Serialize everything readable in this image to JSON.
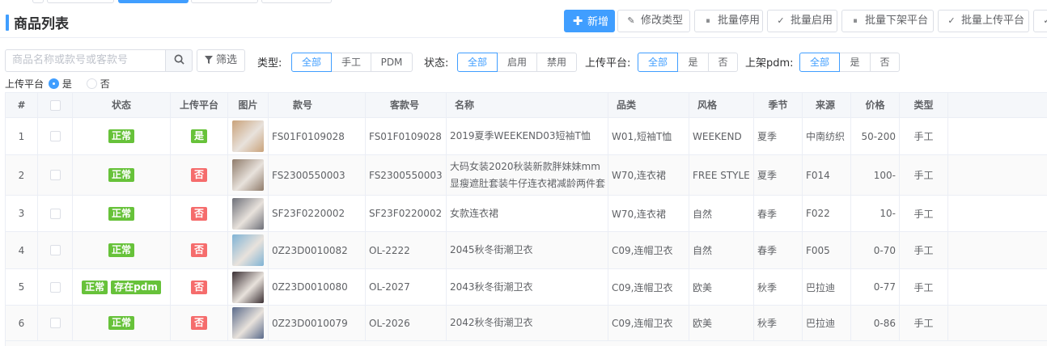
{
  "page": {
    "title": "商品列表"
  },
  "toolbar": [
    {
      "label": "新增",
      "icon": "plus-icon",
      "glyph": "✚",
      "primary": true
    },
    {
      "label": "修改类型",
      "icon": "edit-icon",
      "glyph": "✎",
      "primary": false
    },
    {
      "label": "批量停用",
      "icon": "pause-icon",
      "glyph": "⏸",
      "primary": false
    },
    {
      "label": "批量启用",
      "icon": "check-icon",
      "glyph": "✓",
      "primary": false
    },
    {
      "label": "批量下架平台",
      "icon": "pause-icon",
      "glyph": "⏸",
      "primary": false
    },
    {
      "label": "批量上传平台",
      "icon": "check-icon",
      "glyph": "✓",
      "primary": false
    }
  ],
  "search": {
    "placeholder": "商品名称或款号或客款号",
    "filter_label": "筛选"
  },
  "filters": [
    {
      "label": "类型:",
      "options": [
        "全部",
        "手工",
        "PDM"
      ],
      "selected": 0
    },
    {
      "label": "状态:",
      "options": [
        "全部",
        "启用",
        "禁用"
      ],
      "selected": 0
    },
    {
      "label": "上传平台:",
      "options": [
        "全部",
        "是",
        "否"
      ],
      "selected": 0
    },
    {
      "label": "上架pdm:",
      "options": [
        "全部",
        "是",
        "否"
      ],
      "selected": 0
    }
  ],
  "upload_radio": {
    "label": "上传平台",
    "options": [
      "是",
      "否"
    ],
    "selected": 0
  },
  "table": {
    "columns": [
      "#",
      "",
      "状态",
      "上传平台",
      "图片",
      "款号",
      "客款号",
      "名称",
      "品类",
      "风格",
      "季节",
      "来源",
      "价格",
      "类型"
    ],
    "rows": [
      {
        "index": "1",
        "status": [
          "正常"
        ],
        "upload": "是",
        "upload_color": "#67c23a",
        "code": "FS01F0109028",
        "client_code": "FS01F0109028",
        "name": "2019夏季WEEKEND03短袖T恤",
        "category": "W01,短袖T恤",
        "style": "WEEKEND",
        "season": "夏季",
        "source": "中南纺织",
        "price": "50-200",
        "type": "手工",
        "thumb_color": "#c9a27a"
      },
      {
        "index": "2",
        "status": [
          "正常"
        ],
        "upload": "否",
        "upload_color": "#f56c6c",
        "code": "FS2300550003",
        "client_code": "FS2300550003",
        "name": "大码女装2020秋装新款胖妹妹mm显瘦遮肚套装牛仔连衣裙减龄两件套",
        "category": "W70,连衣裙",
        "style": "FREE STYLE",
        "season": "夏季",
        "source": "F014",
        "price": "100-",
        "type": "手工",
        "thumb_color": "#8f7b6a"
      },
      {
        "index": "3",
        "status": [
          "正常"
        ],
        "upload": "否",
        "upload_color": "#f56c6c",
        "code": "SF23F0220002",
        "client_code": "SF23F0220002",
        "name": "女款连衣裙",
        "category": "W70,连衣裙",
        "style": "自然",
        "season": "春季",
        "source": "F022",
        "price": "10-",
        "type": "手工",
        "thumb_color": "#6d6f78"
      },
      {
        "index": "4",
        "status": [
          "正常"
        ],
        "upload": "否",
        "upload_color": "#f56c6c",
        "code": "0Z23D0010082",
        "client_code": "OL-2222",
        "name": "2045秋冬街潮卫衣",
        "category": "C09,连帽卫衣",
        "style": "自然",
        "season": "春季",
        "source": "F005",
        "price": "0-70",
        "type": "手工",
        "thumb_color": "#7fb3d5"
      },
      {
        "index": "5",
        "status": [
          "正常",
          "存在pdm"
        ],
        "upload": "否",
        "upload_color": "#f56c6c",
        "code": "0Z23D0010080",
        "client_code": "OL-2027",
        "name": "2043秋冬街潮卫衣",
        "category": "C09,连帽卫衣",
        "style": "欧美",
        "season": "秋季",
        "source": "巴拉迪",
        "price": "0-77",
        "type": "手工",
        "thumb_color": "#3a2f33"
      },
      {
        "index": "6",
        "status": [
          "正常"
        ],
        "upload": "否",
        "upload_color": "#f56c6c",
        "code": "0Z23D0010079",
        "client_code": "OL-2026",
        "name": "2042秋冬街潮卫衣",
        "category": "C09,连帽卫衣",
        "style": "欧美",
        "season": "秋季",
        "source": "巴拉迪",
        "price": "0-86",
        "type": "手工",
        "thumb_color": "#5a6a8a"
      }
    ]
  }
}
